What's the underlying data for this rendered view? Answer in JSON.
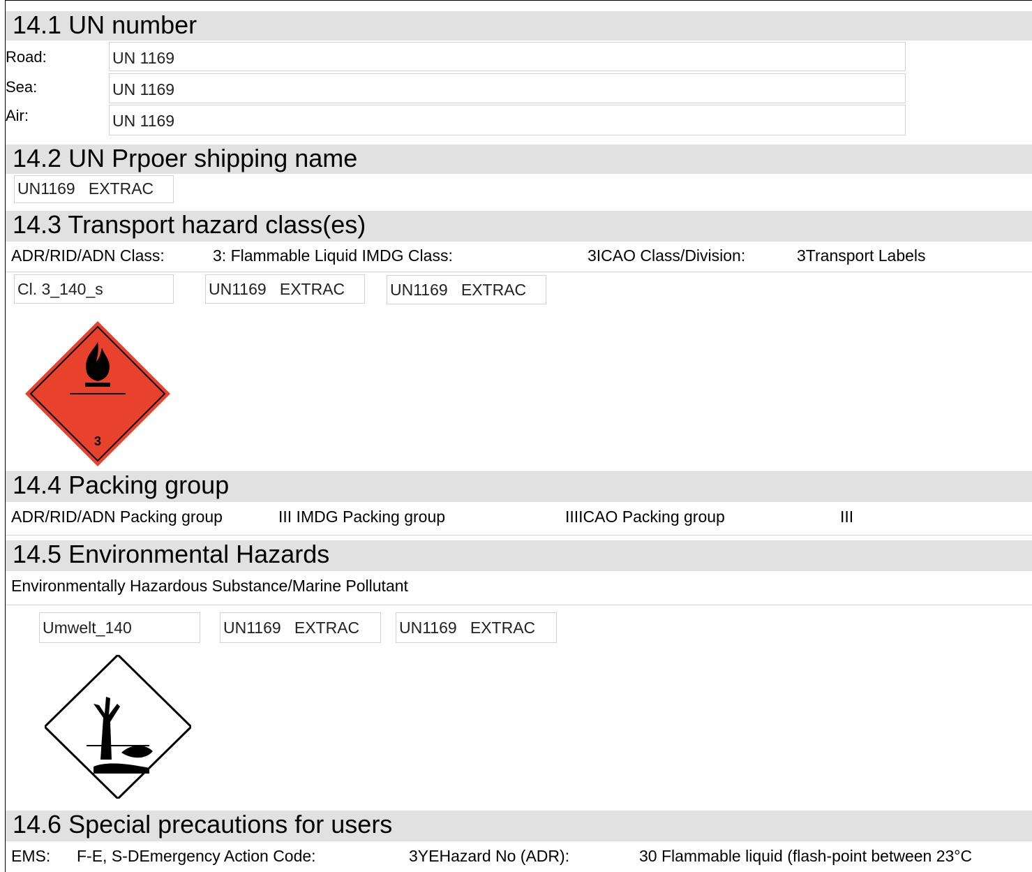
{
  "s141": {
    "title": "14.1 UN number",
    "road_label": "Road:",
    "road_value": "UN 1169",
    "sea_label": "Sea:",
    "sea_value": "UN 1169",
    "air_label": "Air:",
    "air_value": "UN 1169"
  },
  "s142": {
    "title": "14.2 UN Prpoer shipping name",
    "name_box": "UN1169   EXTRAC"
  },
  "s143": {
    "title": "14.3 Transport hazard class(es)",
    "adr_label": "ADR/RID/ADN Class:",
    "adr_value": "3: Flammable Liquid IMDG Class:",
    "imdg_value": "3ICAO Class/Division:",
    "icao_value": "3Transport Labels",
    "label_box1": "Cl. 3_140_s",
    "label_box2": "UN1169   EXTRAC",
    "label_box3": "UN1169   EXTRAC",
    "placard_number": "3",
    "placard_color": "#e8412c"
  },
  "s144": {
    "title": "14.4 Packing group",
    "adr": "ADR/RID/ADN Packing group",
    "imdg": "III IMDG Packing group",
    "icao": "IIIICAO Packing group",
    "icao_value": "III"
  },
  "s145": {
    "title": "14.5 Environmental Hazards",
    "text": "Environmentally Hazardous Substance/Marine Pollutant",
    "box1": "Umwelt_140",
    "box2": "UN1169   EXTRAC",
    "box3": "UN1169   EXTRAC"
  },
  "s146": {
    "title": "14.6 Special precautions for users",
    "ems_label": "EMS:",
    "ems_value": "F-E, S-DEmergency Action Code:",
    "eac_value": "3YEHazard No (ADR):",
    "hazard_value": "30 Flammable liquid (flash-point between 23°C"
  }
}
